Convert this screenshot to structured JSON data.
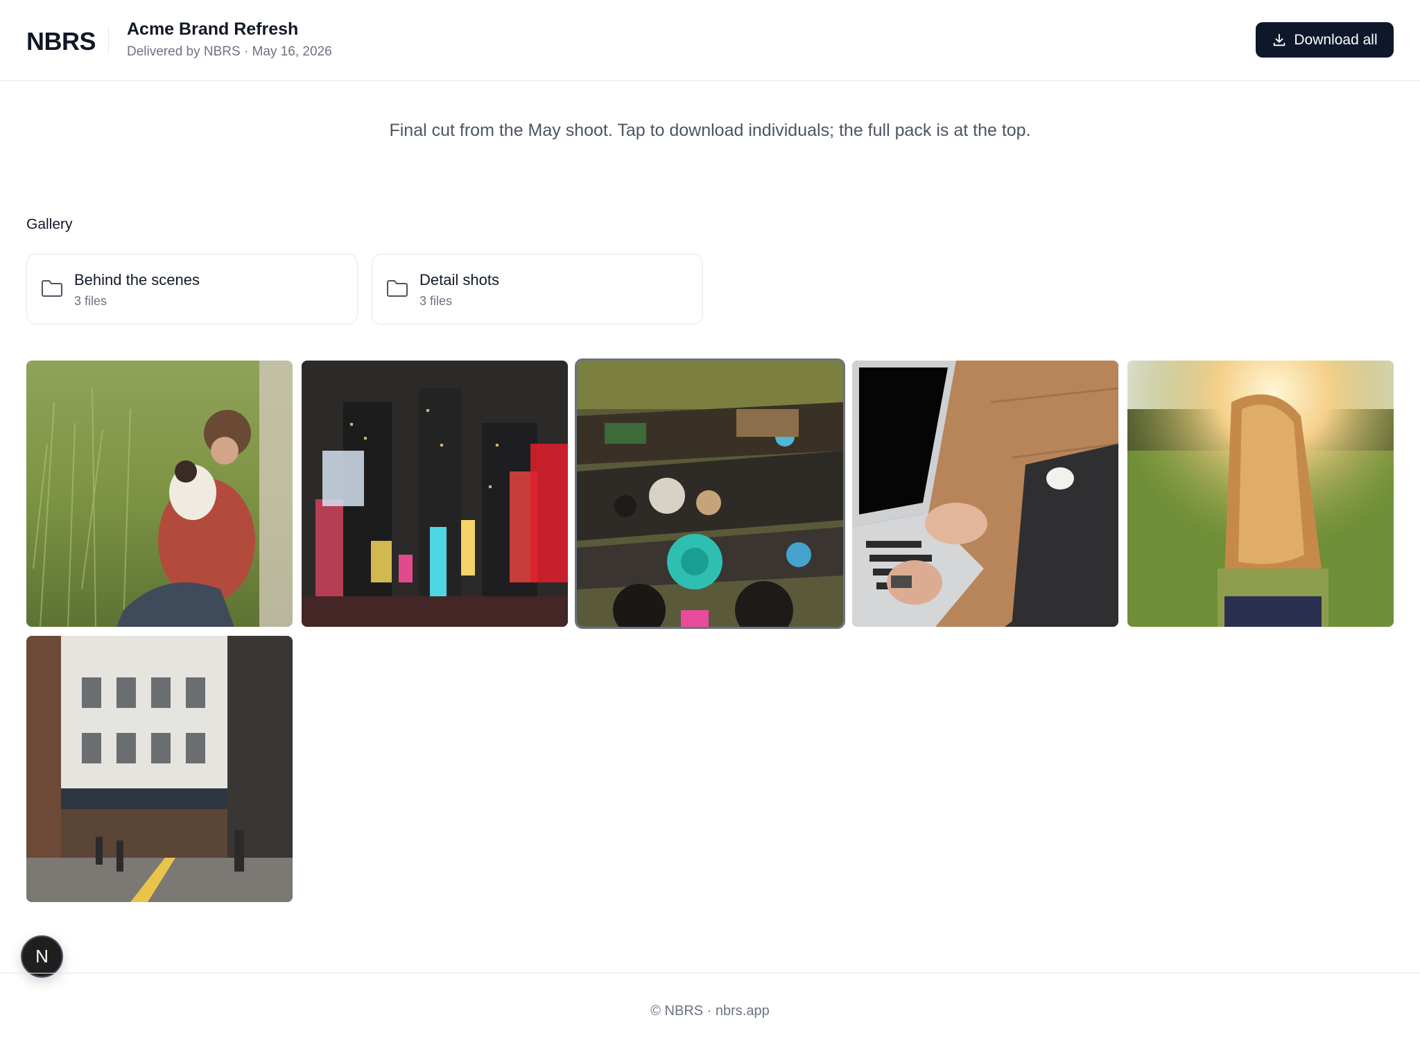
{
  "header": {
    "logo": "NBRS",
    "title": "Acme Brand Refresh",
    "meta": "Delivered by NBRS · May 16, 2026",
    "download_all_label": "Download all",
    "download_icon": "download-icon"
  },
  "description": "Final cut from the May shoot. Tap to download individuals; the full pack is at the top.",
  "gallery": {
    "label": "Gallery",
    "folders": [
      {
        "name": "Behind the scenes",
        "count": "3 files",
        "icon": "folder-icon"
      },
      {
        "name": "Detail shots",
        "count": "3 files",
        "icon": "folder-icon"
      }
    ],
    "photos": [
      {
        "subject": "man-with-dog-in-grass",
        "selected": false
      },
      {
        "subject": "city-night-times-square",
        "selected": false
      },
      {
        "subject": "floating-market-boats",
        "selected": true
      },
      {
        "subject": "laptop-typing-on-wood-desk",
        "selected": false
      },
      {
        "subject": "woman-in-sunlit-field",
        "selected": false
      },
      {
        "subject": "london-street-building",
        "selected": false
      }
    ]
  },
  "badge": {
    "letter": "N"
  },
  "footer": {
    "text": "© NBRS · nbrs.app"
  },
  "colors": {
    "primary_button": "#0f172a",
    "border": "#e5e7eb",
    "muted_text": "#6b7280",
    "body_text": "#4b5563"
  }
}
